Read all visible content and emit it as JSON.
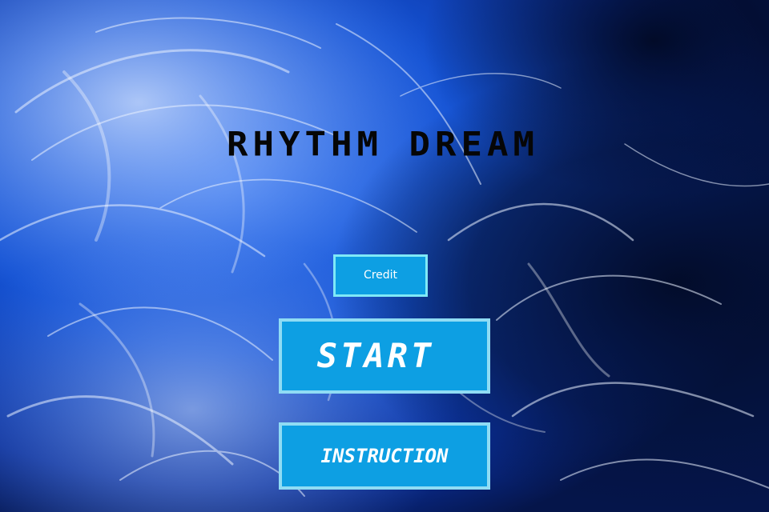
{
  "game": {
    "title": "RHYTHM DREAM"
  },
  "menu": {
    "credit_label": "Credit",
    "start_label": "START",
    "instruction_label": "INSTRUCTION"
  },
  "colors": {
    "background_primary": "#0a3fb0",
    "background_dark": "#061a48",
    "button_fill": "#0d9fe3",
    "button_border": "#8fdcf4",
    "title_color": "#060606"
  }
}
